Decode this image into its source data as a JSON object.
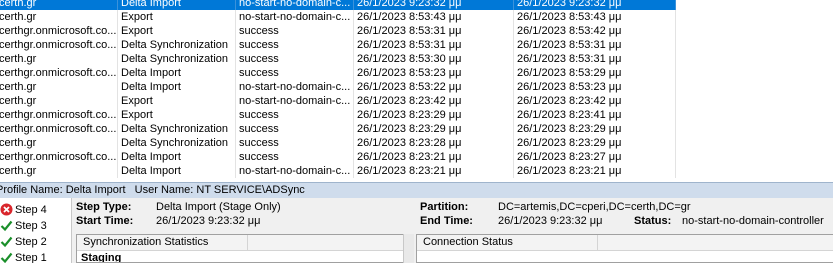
{
  "runs": {
    "rows": [
      {
        "profile": "certh.gr",
        "type": "Delta Import",
        "status": "no-start-no-domain-c...",
        "start": "26/1/2023 9:23:32 μμ",
        "end": "26/1/2023 9:23:32 μμ",
        "selected": true
      },
      {
        "profile": "certh.gr",
        "type": "Export",
        "status": "no-start-no-domain-c...",
        "start": "26/1/2023 8:53:43 μμ",
        "end": "26/1/2023 8:53:43 μμ"
      },
      {
        "profile": "certhgr.onmicrosoft.co...",
        "type": "Export",
        "status": "success",
        "start": "26/1/2023 8:53:31 μμ",
        "end": "26/1/2023 8:53:42 μμ"
      },
      {
        "profile": "certhgr.onmicrosoft.co...",
        "type": "Delta Synchronization",
        "status": "success",
        "start": "26/1/2023 8:53:31 μμ",
        "end": "26/1/2023 8:53:31 μμ"
      },
      {
        "profile": "certh.gr",
        "type": "Delta Synchronization",
        "status": "success",
        "start": "26/1/2023 8:53:30 μμ",
        "end": "26/1/2023 8:53:31 μμ"
      },
      {
        "profile": "certhgr.onmicrosoft.co...",
        "type": "Delta Import",
        "status": "success",
        "start": "26/1/2023 8:53:23 μμ",
        "end": "26/1/2023 8:53:29 μμ"
      },
      {
        "profile": "certh.gr",
        "type": "Delta Import",
        "status": "no-start-no-domain-c...",
        "start": "26/1/2023 8:53:22 μμ",
        "end": "26/1/2023 8:53:23 μμ"
      },
      {
        "profile": "certh.gr",
        "type": "Export",
        "status": "no-start-no-domain-c...",
        "start": "26/1/2023 8:23:42 μμ",
        "end": "26/1/2023 8:23:42 μμ"
      },
      {
        "profile": "certhgr.onmicrosoft.co...",
        "type": "Export",
        "status": "success",
        "start": "26/1/2023 8:23:29 μμ",
        "end": "26/1/2023 8:23:41 μμ"
      },
      {
        "profile": "certhgr.onmicrosoft.co...",
        "type": "Delta Synchronization",
        "status": "success",
        "start": "26/1/2023 8:23:29 μμ",
        "end": "26/1/2023 8:23:29 μμ"
      },
      {
        "profile": "certh.gr",
        "type": "Delta Synchronization",
        "status": "success",
        "start": "26/1/2023 8:23:28 μμ",
        "end": "26/1/2023 8:23:29 μμ"
      },
      {
        "profile": "certhgr.onmicrosoft.co...",
        "type": "Delta Import",
        "status": "success",
        "start": "26/1/2023 8:23:21 μμ",
        "end": "26/1/2023 8:23:27 μμ"
      },
      {
        "profile": "certh.gr",
        "type": "Delta Import",
        "status": "no-start-no-domain-c...",
        "start": "26/1/2023 8:23:21 μμ",
        "end": "26/1/2023 8:23:21 μμ"
      }
    ]
  },
  "profile_bar": {
    "profile_name": "Profile Name: Delta Import",
    "user_name": "User Name: NT SERVICE\\ADSync"
  },
  "steps": [
    {
      "label": "Step 4",
      "state": "error"
    },
    {
      "label": "Step 3",
      "state": "ok"
    },
    {
      "label": "Step 2",
      "state": "ok"
    },
    {
      "label": "Step 1",
      "state": "ok"
    }
  ],
  "details": {
    "step_type_label": "Step Type:",
    "step_type": "Delta Import (Stage Only)",
    "start_time_label": "Start Time:",
    "start_time": "26/1/2023 9:23:32 μμ",
    "partition_label": "Partition:",
    "partition": "DC=artemis,DC=cperi,DC=certh,DC=gr",
    "end_time_label": "End Time:",
    "end_time": "26/1/2023 9:23:32 μμ",
    "status_label": "Status:",
    "status": "no-start-no-domain-controller"
  },
  "panels": {
    "sync_stats": "Synchronization Statistics",
    "staging": "Staging",
    "connection_status": "Connection Status"
  },
  "colors": {
    "selection": "#0078d7",
    "profile_bar": "#cfdcec"
  }
}
